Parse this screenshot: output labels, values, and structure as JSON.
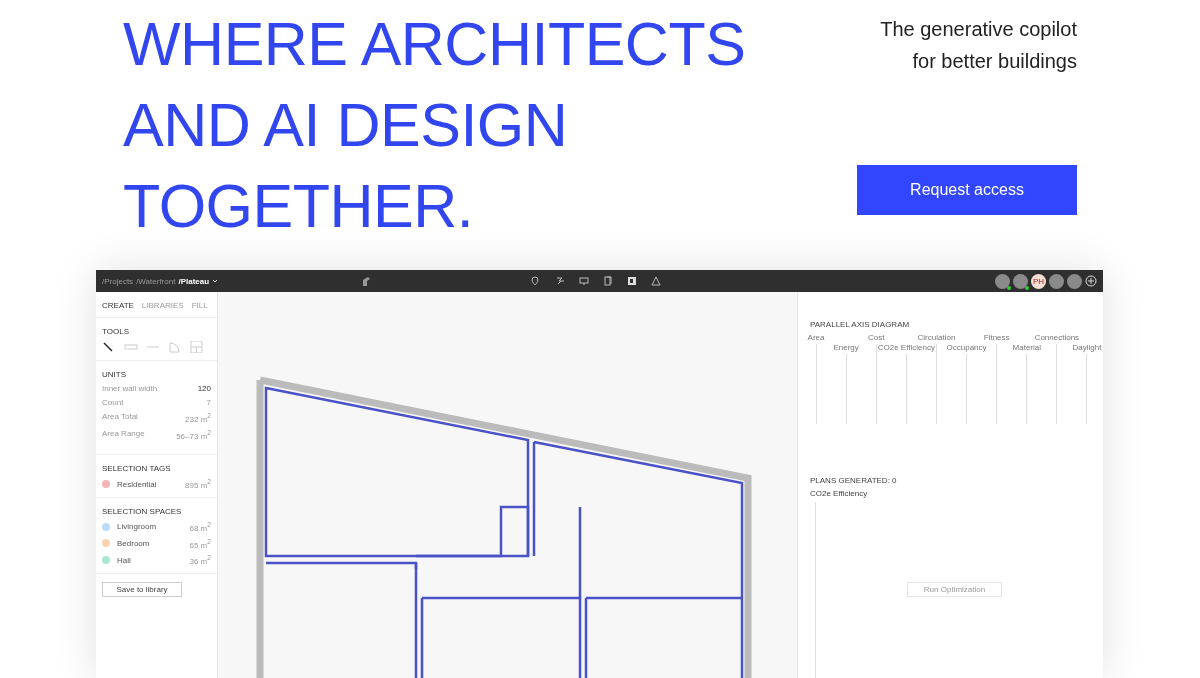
{
  "hero": {
    "headline": [
      "WHERE ARCHITECTS",
      "AND AI DESIGN",
      "TOGETHER."
    ],
    "tagline": [
      "The generative copilot",
      "for better buildings"
    ],
    "cta": "Request access"
  },
  "app": {
    "breadcrumb": [
      {
        "label": "/Projects",
        "current": false
      },
      {
        "label": "/Waterfront",
        "current": false
      },
      {
        "label": "/Plateau",
        "current": true
      }
    ],
    "avatars": [
      {
        "kind": "photo",
        "online": true
      },
      {
        "kind": "photo",
        "online": true
      },
      {
        "kind": "initials",
        "text": "PH",
        "online": false
      },
      {
        "kind": "photo",
        "online": false
      },
      {
        "kind": "photo",
        "online": false
      }
    ],
    "tabs": [
      {
        "label": "CREATE",
        "selected": true
      },
      {
        "label": "LIBRARIES",
        "selected": false
      },
      {
        "label": "FILL",
        "selected": false
      }
    ],
    "tools": {
      "title": "TOOLS",
      "items": [
        {
          "kind": "pen",
          "selected": true
        },
        {
          "kind": "wall",
          "selected": false
        },
        {
          "kind": "line",
          "selected": false
        },
        {
          "kind": "door",
          "selected": false
        },
        {
          "kind": "grid",
          "selected": false
        }
      ]
    },
    "units": {
      "title": "UNITS",
      "rows": [
        {
          "label": "Inner wall width",
          "value": "120",
          "emphasis": true
        },
        {
          "label": "Count",
          "value": "7",
          "emphasis": false
        },
        {
          "label": "Area Total",
          "value": "232 m$^{2}$",
          "emphasis": false
        },
        {
          "label": "Area Range",
          "value": "56–73 m$^{2}$",
          "emphasis": false
        }
      ]
    },
    "selection_tags": {
      "title": "SELECTION TAGS",
      "items": [
        {
          "label": "Residential",
          "value": "895 m$^{2}$",
          "color": "#f5b5b8"
        }
      ]
    },
    "selection_spaces": {
      "title": "SELECTION SPACES",
      "items": [
        {
          "label": "Livingroom",
          "value": "68 m$^{2}$",
          "color": "#b8dcf5"
        },
        {
          "label": "Bedroom",
          "value": "65 m$^{2}$",
          "color": "#fbd3b0"
        },
        {
          "label": "Hall",
          "value": "36 m$^{2}$",
          "color": "#a8e8cf"
        }
      ]
    },
    "save_button": "Save to library",
    "parallel_axis": {
      "title": "PARALLEL AXIS DIAGRAM",
      "axes": [
        "Area",
        "Energy",
        "Cost",
        "CO2e Efficiency",
        "Circulation",
        "Occupancy",
        "Fitness",
        "Material",
        "Connections",
        "Daylight"
      ]
    },
    "plans": {
      "title": "PLANS GENERATED: 0",
      "metric": "CO2e Efficiency",
      "button": {
        "label": "Run Optimization",
        "disabled": true
      }
    }
  }
}
